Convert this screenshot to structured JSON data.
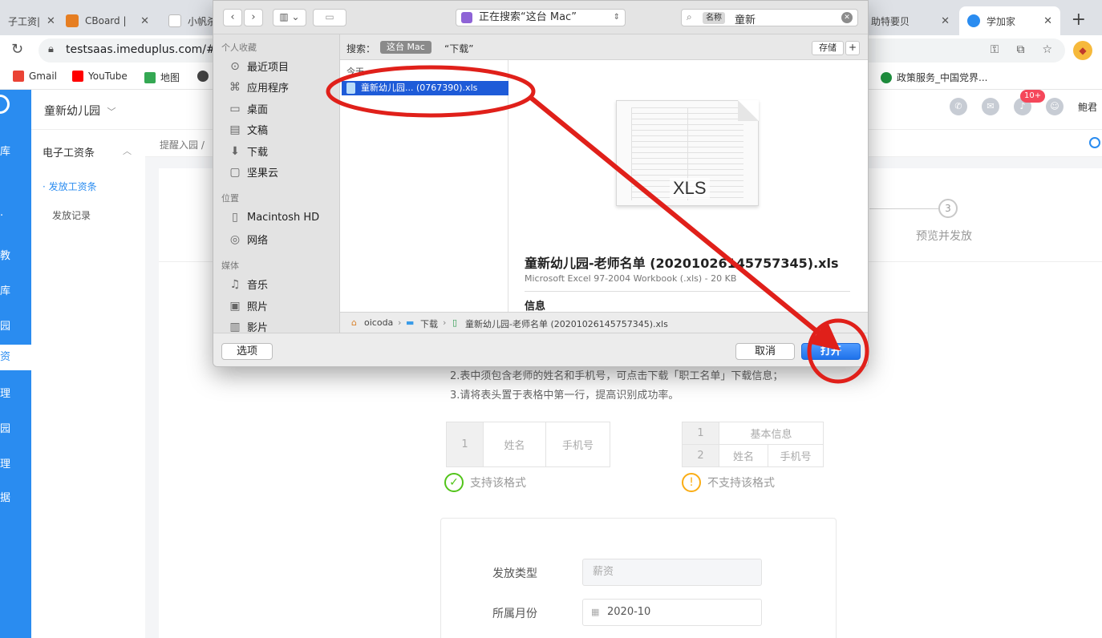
{
  "browser": {
    "tabs": [
      {
        "label": "子工资|",
        "favicon_color": "#2a8cf0"
      },
      {
        "label": "CBoard | ",
        "favicon_color": "#e67e22"
      },
      {
        "label": "小帆杀",
        "favicon_color": "#bbbbbb"
      },
      {
        "label": "助特要贝",
        "favicon_color": "#bbbbbb"
      },
      {
        "label": "学加家",
        "favicon_color": "#2a8cf0"
      }
    ],
    "close_glyph": "✕",
    "new_tab_glyph": "+",
    "url": "testsaas.imeduplus.com/#/",
    "bookmarks": [
      {
        "label": "Gmail",
        "color": "#ea4335"
      },
      {
        "label": "YouTube",
        "color": "#ff0000"
      },
      {
        "label": "地图",
        "color": "#34a853"
      },
      {
        "label": "政策服务_中国党界...",
        "color": "#1e8e3e"
      }
    ]
  },
  "app": {
    "org_name": "童新幼儿园",
    "org_chevron": "﹀",
    "rail_items": [
      "库",
      "·",
      "教",
      "库",
      "园",
      "资",
      "理",
      "园",
      "理",
      "据"
    ],
    "rail_selected_index": 5,
    "badge": "10+",
    "user_name": "鲍君",
    "menu": {
      "title": "电子工资条",
      "items": [
        "· 发放工资条",
        "发放记录"
      ]
    },
    "breadcrumb": "提醒入园 /",
    "step3": {
      "num": "3",
      "label": "预览并发放"
    },
    "notes": [
      "2.表中须包含老师的姓名和手机号，可点击下载「职工名单」下载信息；",
      "3.请将表头置于表格中第一行，提高识别成功率。"
    ],
    "good_table": {
      "num": "1",
      "col1": "姓名",
      "col2": "手机号"
    },
    "good_label": "支持该格式",
    "bad_table": {
      "num1": "1",
      "merged": "基本信息",
      "num2": "2",
      "col1": "姓名",
      "col2": "手机号"
    },
    "bad_label": "不支持该格式",
    "form": {
      "type_label": "发放类型",
      "type_value": "薪资",
      "month_label": "所属月份",
      "month_value": "2020-10"
    }
  },
  "dialog": {
    "back": "‹",
    "forward": "›",
    "location": "正在搜索“这台 Mac”",
    "search_token": "名称",
    "search_query": "童新",
    "sidebar": {
      "favorites_head": "个人收藏",
      "favorites": [
        {
          "label": "最近项目",
          "icon": "clock-icon",
          "glyph": "⊙"
        },
        {
          "label": "应用程序",
          "icon": "apps-icon",
          "glyph": "⌘"
        },
        {
          "label": "桌面",
          "icon": "desktop-icon",
          "glyph": "▭"
        },
        {
          "label": "文稿",
          "icon": "documents-icon",
          "glyph": "▤"
        },
        {
          "label": "下载",
          "icon": "download-icon",
          "glyph": "⬇"
        },
        {
          "label": "坚果云",
          "icon": "folder-icon",
          "glyph": "▢"
        }
      ],
      "locations_head": "位置",
      "locations": [
        {
          "label": "Macintosh HD",
          "icon": "disk-icon",
          "glyph": "▯"
        },
        {
          "label": "网络",
          "icon": "network-icon",
          "glyph": "◎"
        }
      ],
      "media_head": "媒体",
      "media": [
        {
          "label": "音乐",
          "icon": "music-icon",
          "glyph": "♫"
        },
        {
          "label": "照片",
          "icon": "photos-icon",
          "glyph": "▣"
        },
        {
          "label": "影片",
          "icon": "movies-icon",
          "glyph": "▥"
        }
      ]
    },
    "scope_label": "搜索：",
    "scope_active": "这台 Mac",
    "scope_other": "“下载”",
    "save_label": "存储",
    "plus": "+",
    "today_head": "今天",
    "selected_file": "童新幼儿园... (0767390).xls",
    "preview_ext": "XLS",
    "preview_name": "童新幼儿园-老师名单 (20201026145757345).xls",
    "preview_kind": "Microsoft Excel 97-2004 Workbook (.xls) - 20 KB",
    "info_head": "信息",
    "path": {
      "user": "oicoda",
      "folder": "下载",
      "file": "童新幼儿园-老师名单 (20201026145757345).xls"
    },
    "options_label": "选项",
    "cancel_label": "取消",
    "open_label": "打开"
  },
  "annotation_color": "#e0201a"
}
